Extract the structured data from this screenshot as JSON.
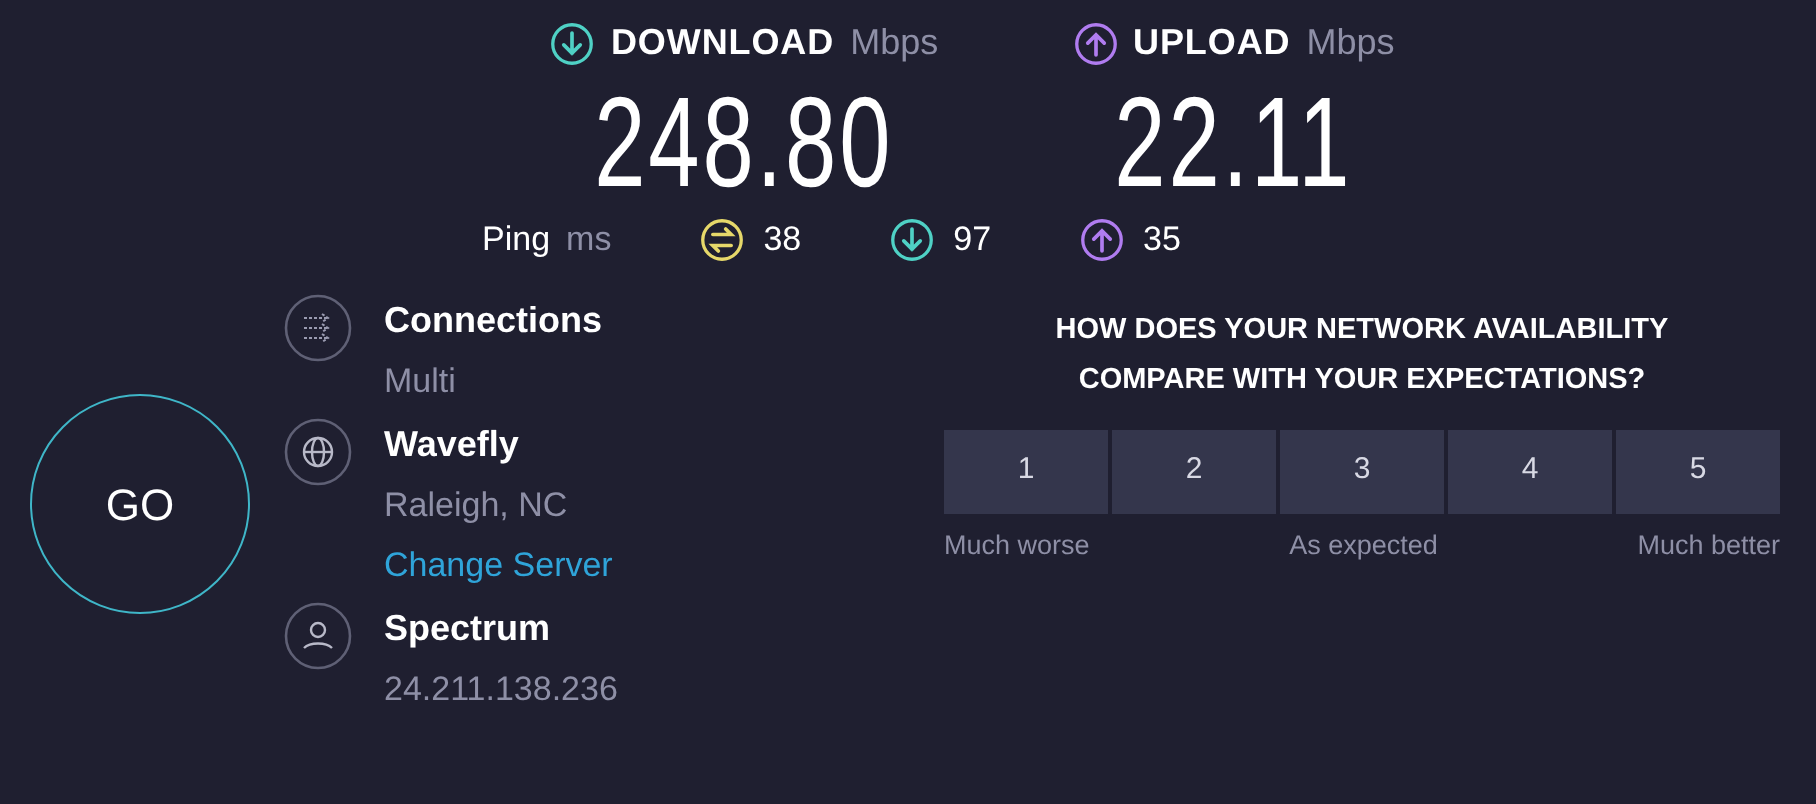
{
  "results": [
    {
      "kind": "download",
      "label": "DOWNLOAD",
      "unit": "Mbps",
      "value": "248.80"
    },
    {
      "kind": "upload",
      "label": "UPLOAD",
      "unit": "Mbps",
      "value": "22.11"
    }
  ],
  "ping": {
    "label": "Ping",
    "unit": "ms",
    "items": [
      {
        "kind": "idle",
        "value": "38"
      },
      {
        "kind": "download",
        "value": "97"
      },
      {
        "kind": "upload",
        "value": "35"
      }
    ]
  },
  "go_button": "GO",
  "details": [
    {
      "kind": "connections",
      "title": "Connections",
      "subtitle": "Multi"
    },
    {
      "kind": "server",
      "title": "Wavefly",
      "subtitle": "Raleigh, NC",
      "link": "Change Server"
    },
    {
      "kind": "provider",
      "title": "Spectrum",
      "subtitle": "24.211.138.236"
    }
  ],
  "survey": {
    "question": "HOW DOES YOUR NETWORK AVAILABILITY COMPARE WITH YOUR EXPECTATIONS?",
    "options": [
      {
        "label": "1",
        "selected": false
      },
      {
        "label": "2",
        "selected": false
      },
      {
        "label": "3",
        "selected": false
      },
      {
        "label": "4",
        "selected": false
      },
      {
        "label": "5",
        "selected": false
      }
    ],
    "scale_labels": [
      "Much worse",
      "As expected",
      "Much better"
    ]
  }
}
